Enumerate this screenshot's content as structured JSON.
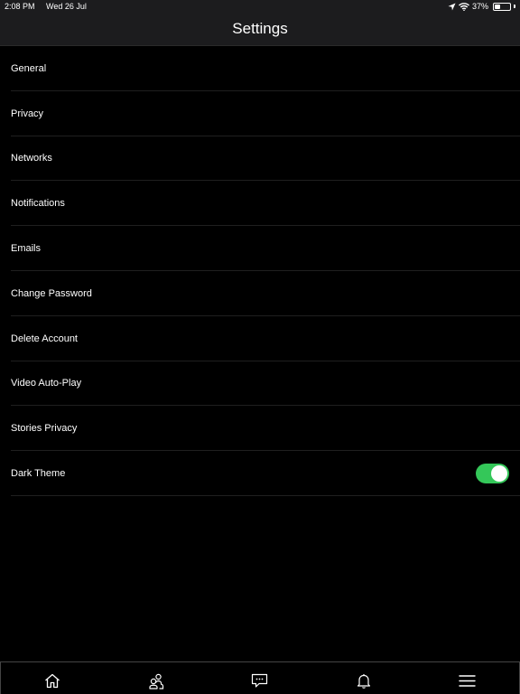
{
  "status_bar": {
    "time": "2:08 PM",
    "date": "Wed 26 Jul",
    "battery": "37%",
    "battery_level": 0.37
  },
  "header": {
    "title": "Settings"
  },
  "settings": {
    "items": [
      {
        "label": "General"
      },
      {
        "label": "Privacy"
      },
      {
        "label": "Networks"
      },
      {
        "label": "Notifications"
      },
      {
        "label": "Emails"
      },
      {
        "label": "Change Password"
      },
      {
        "label": "Delete Account"
      },
      {
        "label": "Video Auto-Play"
      },
      {
        "label": "Stories Privacy"
      },
      {
        "label": "Dark Theme",
        "toggle": true,
        "enabled": true
      }
    ]
  },
  "tab_bar": {
    "tabs": [
      {
        "icon": "home-icon"
      },
      {
        "icon": "people-icon"
      },
      {
        "icon": "chat-icon"
      },
      {
        "icon": "bell-icon"
      },
      {
        "icon": "menu-icon"
      }
    ]
  },
  "colors": {
    "background": "#000000",
    "header": "#1c1c1e",
    "toggle_on": "#34c759",
    "text": "#ffffff"
  }
}
